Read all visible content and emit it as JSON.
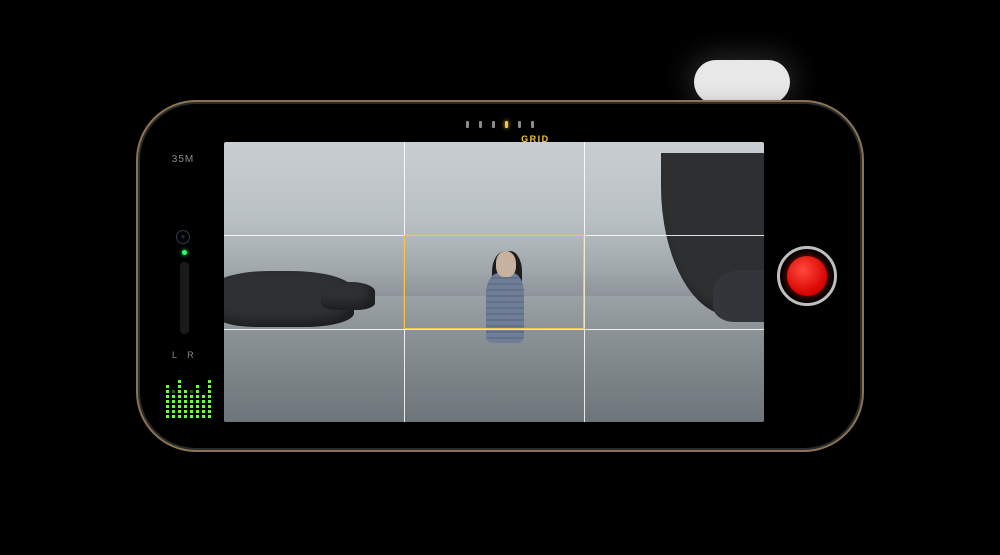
{
  "flash": {
    "on": true
  },
  "overlay": {
    "grid_label": "GRID",
    "sensor_dots": [
      false,
      false,
      false,
      true,
      false,
      false
    ]
  },
  "left": {
    "resolution": "35M",
    "channels": "L  R"
  },
  "controls": {
    "record": "record"
  }
}
